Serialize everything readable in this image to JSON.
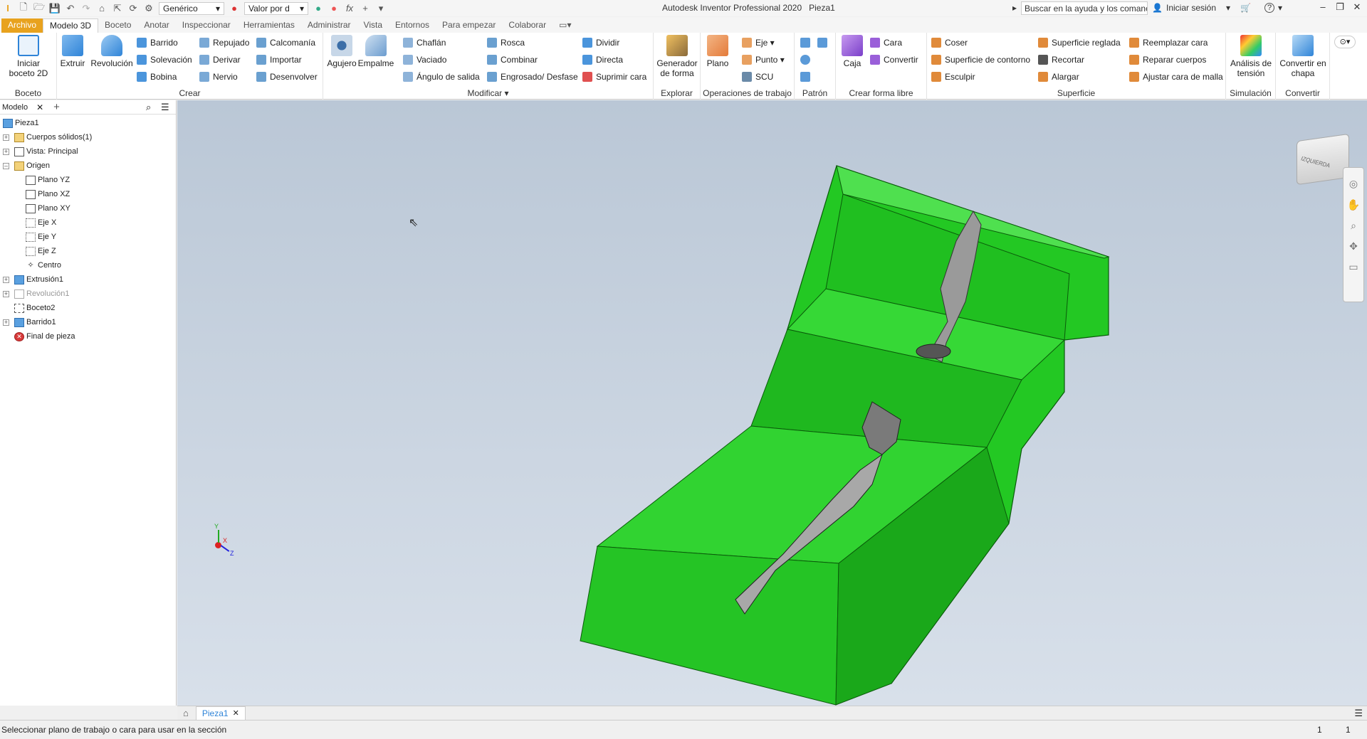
{
  "titlebar": {
    "style_select": "Genérico",
    "appearance_select": "Valor por d",
    "fx": "fx",
    "app_title": "Autodesk Inventor Professional 2020",
    "doc_title": "Pieza1",
    "search_placeholder": "Buscar en la ayuda y los comanc",
    "signin": "Iniciar sesión",
    "help": "?"
  },
  "tabs": [
    "Archivo",
    "Modelo 3D",
    "Boceto",
    "Anotar",
    "Inspeccionar",
    "Herramientas",
    "Administrar",
    "Vista",
    "Entornos",
    "Para empezar",
    "Colaborar"
  ],
  "ribbon": {
    "boceto": {
      "title": "Boceto",
      "start_sketch": "Iniciar boceto 2D"
    },
    "crear": {
      "title": "Crear",
      "extruir": "Extruir",
      "revolucion": "Revolución",
      "barrido": "Barrido",
      "solevacion": "Solevación",
      "bobina": "Bobina",
      "repujado": "Repujado",
      "derivar": "Derivar",
      "nervio": "Nervio",
      "calcomania": "Calcomanía",
      "importar": "Importar",
      "desenvolver": "Desenvolver"
    },
    "modificar": {
      "title": "Modificar",
      "agujero": "Agujero",
      "empalme": "Empalme",
      "chaflan": "Chaflán",
      "vaciado": "Vaciado",
      "angulo": "Ángulo de salida",
      "rosca": "Rosca",
      "combinar": "Combinar",
      "engrosado": "Engrosado/ Desfase",
      "dividir": "Dividir",
      "directa": "Directa",
      "suprimir": "Suprimir cara"
    },
    "explorar": {
      "title": "Explorar",
      "generador": "Generador de forma"
    },
    "operaciones": {
      "title": "Operaciones de trabajo",
      "plano": "Plano",
      "eje": "Eje",
      "punto": "Punto",
      "scu": "SCU"
    },
    "patron": {
      "title": "Patrón"
    },
    "forma_libre": {
      "title": "Crear forma libre",
      "caja": "Caja",
      "cara": "Cara",
      "convertir": "Convertir"
    },
    "superficie": {
      "title": "Superficie",
      "coser": "Coser",
      "sup_contorno": "Superficie de contorno",
      "esculpir": "Esculpir",
      "sup_reglada": "Superficie reglada",
      "recortar": "Recortar",
      "alargar": "Alargar",
      "reemplazar": "Reemplazar cara",
      "reparar": "Reparar cuerpos",
      "ajustar": "Ajustar cara de malla"
    },
    "simulacion": {
      "title": "Simulación",
      "analisis": "Análisis de tensión"
    },
    "convertir": {
      "title": "Convertir",
      "chapa": "Convertir en chapa"
    }
  },
  "browser": {
    "tab": "Modelo",
    "nodes": [
      "Pieza1",
      "Cuerpos sólidos(1)",
      "Vista: Principal",
      "Origen",
      "Plano YZ",
      "Plano XZ",
      "Plano XY",
      "Eje X",
      "Eje Y",
      "Eje Z",
      "Centro",
      "Extrusión1",
      "Revolución1",
      "Boceto2",
      "Barrido1",
      "Final de pieza"
    ]
  },
  "viewcube": {
    "label": "IZQUIERDA"
  },
  "triad": {
    "x": "X",
    "y": "Y",
    "z": "Z"
  },
  "docbar": {
    "tab": "Pieza1"
  },
  "status": {
    "message": "Seleccionar plano de trabajo o cara para usar en la sección",
    "count_a": "1",
    "count_b": "1"
  },
  "colors": {
    "part_green": "#22c822",
    "file_tab": "#e8a21e",
    "accent_blue": "#2f84d8"
  }
}
